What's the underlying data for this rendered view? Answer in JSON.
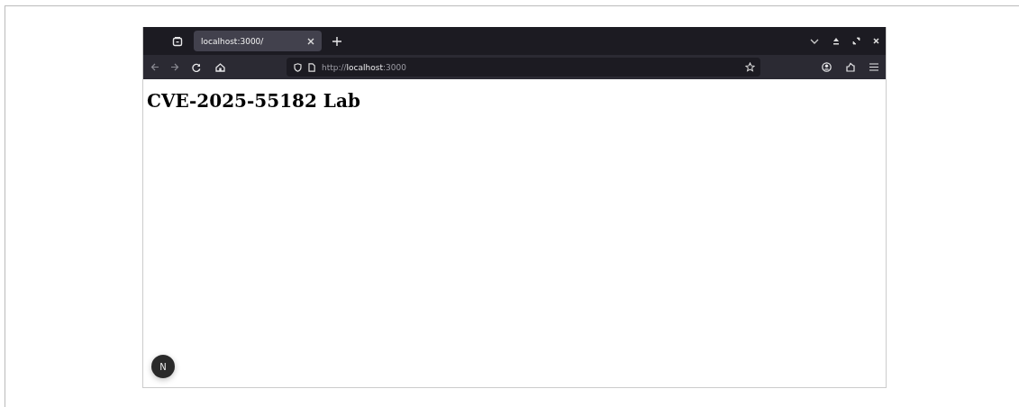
{
  "tabs": [
    {
      "title": "localhost:3000/",
      "selected": true
    }
  ],
  "address_bar": {
    "url": "http://**localhost**:3000"
  },
  "page": {
    "heading": "CVE-2025-55182 Lab"
  },
  "dev_indicator": {
    "label": "N"
  }
}
